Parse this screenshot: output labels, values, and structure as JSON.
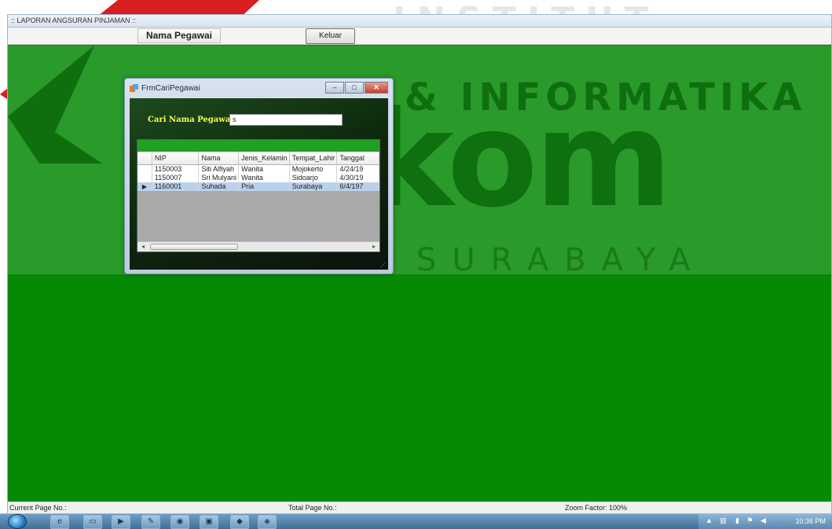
{
  "watermark": {
    "line1": "INSTITUT BISNIS",
    "line2": "& INFORMATIKA",
    "line3": "stikom",
    "line4": "SURABAYA"
  },
  "window": {
    "title": ":: LAPORAN ANGSURAN PINJAMAN ::",
    "tab_label": "Nama Pegawai",
    "exit_button": "Keluar"
  },
  "dialog": {
    "title": "FrmCariPegawai",
    "minimize_icon": "minimize-icon",
    "maximize_icon": "maximize-icon",
    "close_icon": "close-icon",
    "search_label": "Cari Nama Pegawai",
    "search_value": "s",
    "grid": {
      "columns": [
        "NIP",
        "Nama",
        "Jenis_Kelamin",
        "Tempat_Lahir",
        "Tanggal"
      ],
      "rows": [
        {
          "nip": "1150003",
          "nama": "Siti Alfiyah",
          "jk": "Wanita",
          "tempat": "Mojokerto",
          "tanggal": "4/24/19"
        },
        {
          "nip": "1150007",
          "nama": "Sri Mulyani",
          "jk": "Wanita",
          "tempat": "Sidoarjo",
          "tanggal": "4/30/19"
        },
        {
          "nip": "1160001",
          "nama": "Suhada",
          "jk": "Pria",
          "tempat": "Surabaya",
          "tanggal": "6/4/197"
        }
      ],
      "selected_row_index": 2
    }
  },
  "statusbar": {
    "current_page": "Current Page No.:",
    "total_page": "Total Page No.:",
    "zoom": "Zoom Factor: 100%"
  },
  "taskbar": {
    "clock": "10:36 PM"
  },
  "colors": {
    "background_green": "#068a06",
    "search_label_yellow": "#f6ff4d",
    "selected_row": "#b9d1ea"
  }
}
